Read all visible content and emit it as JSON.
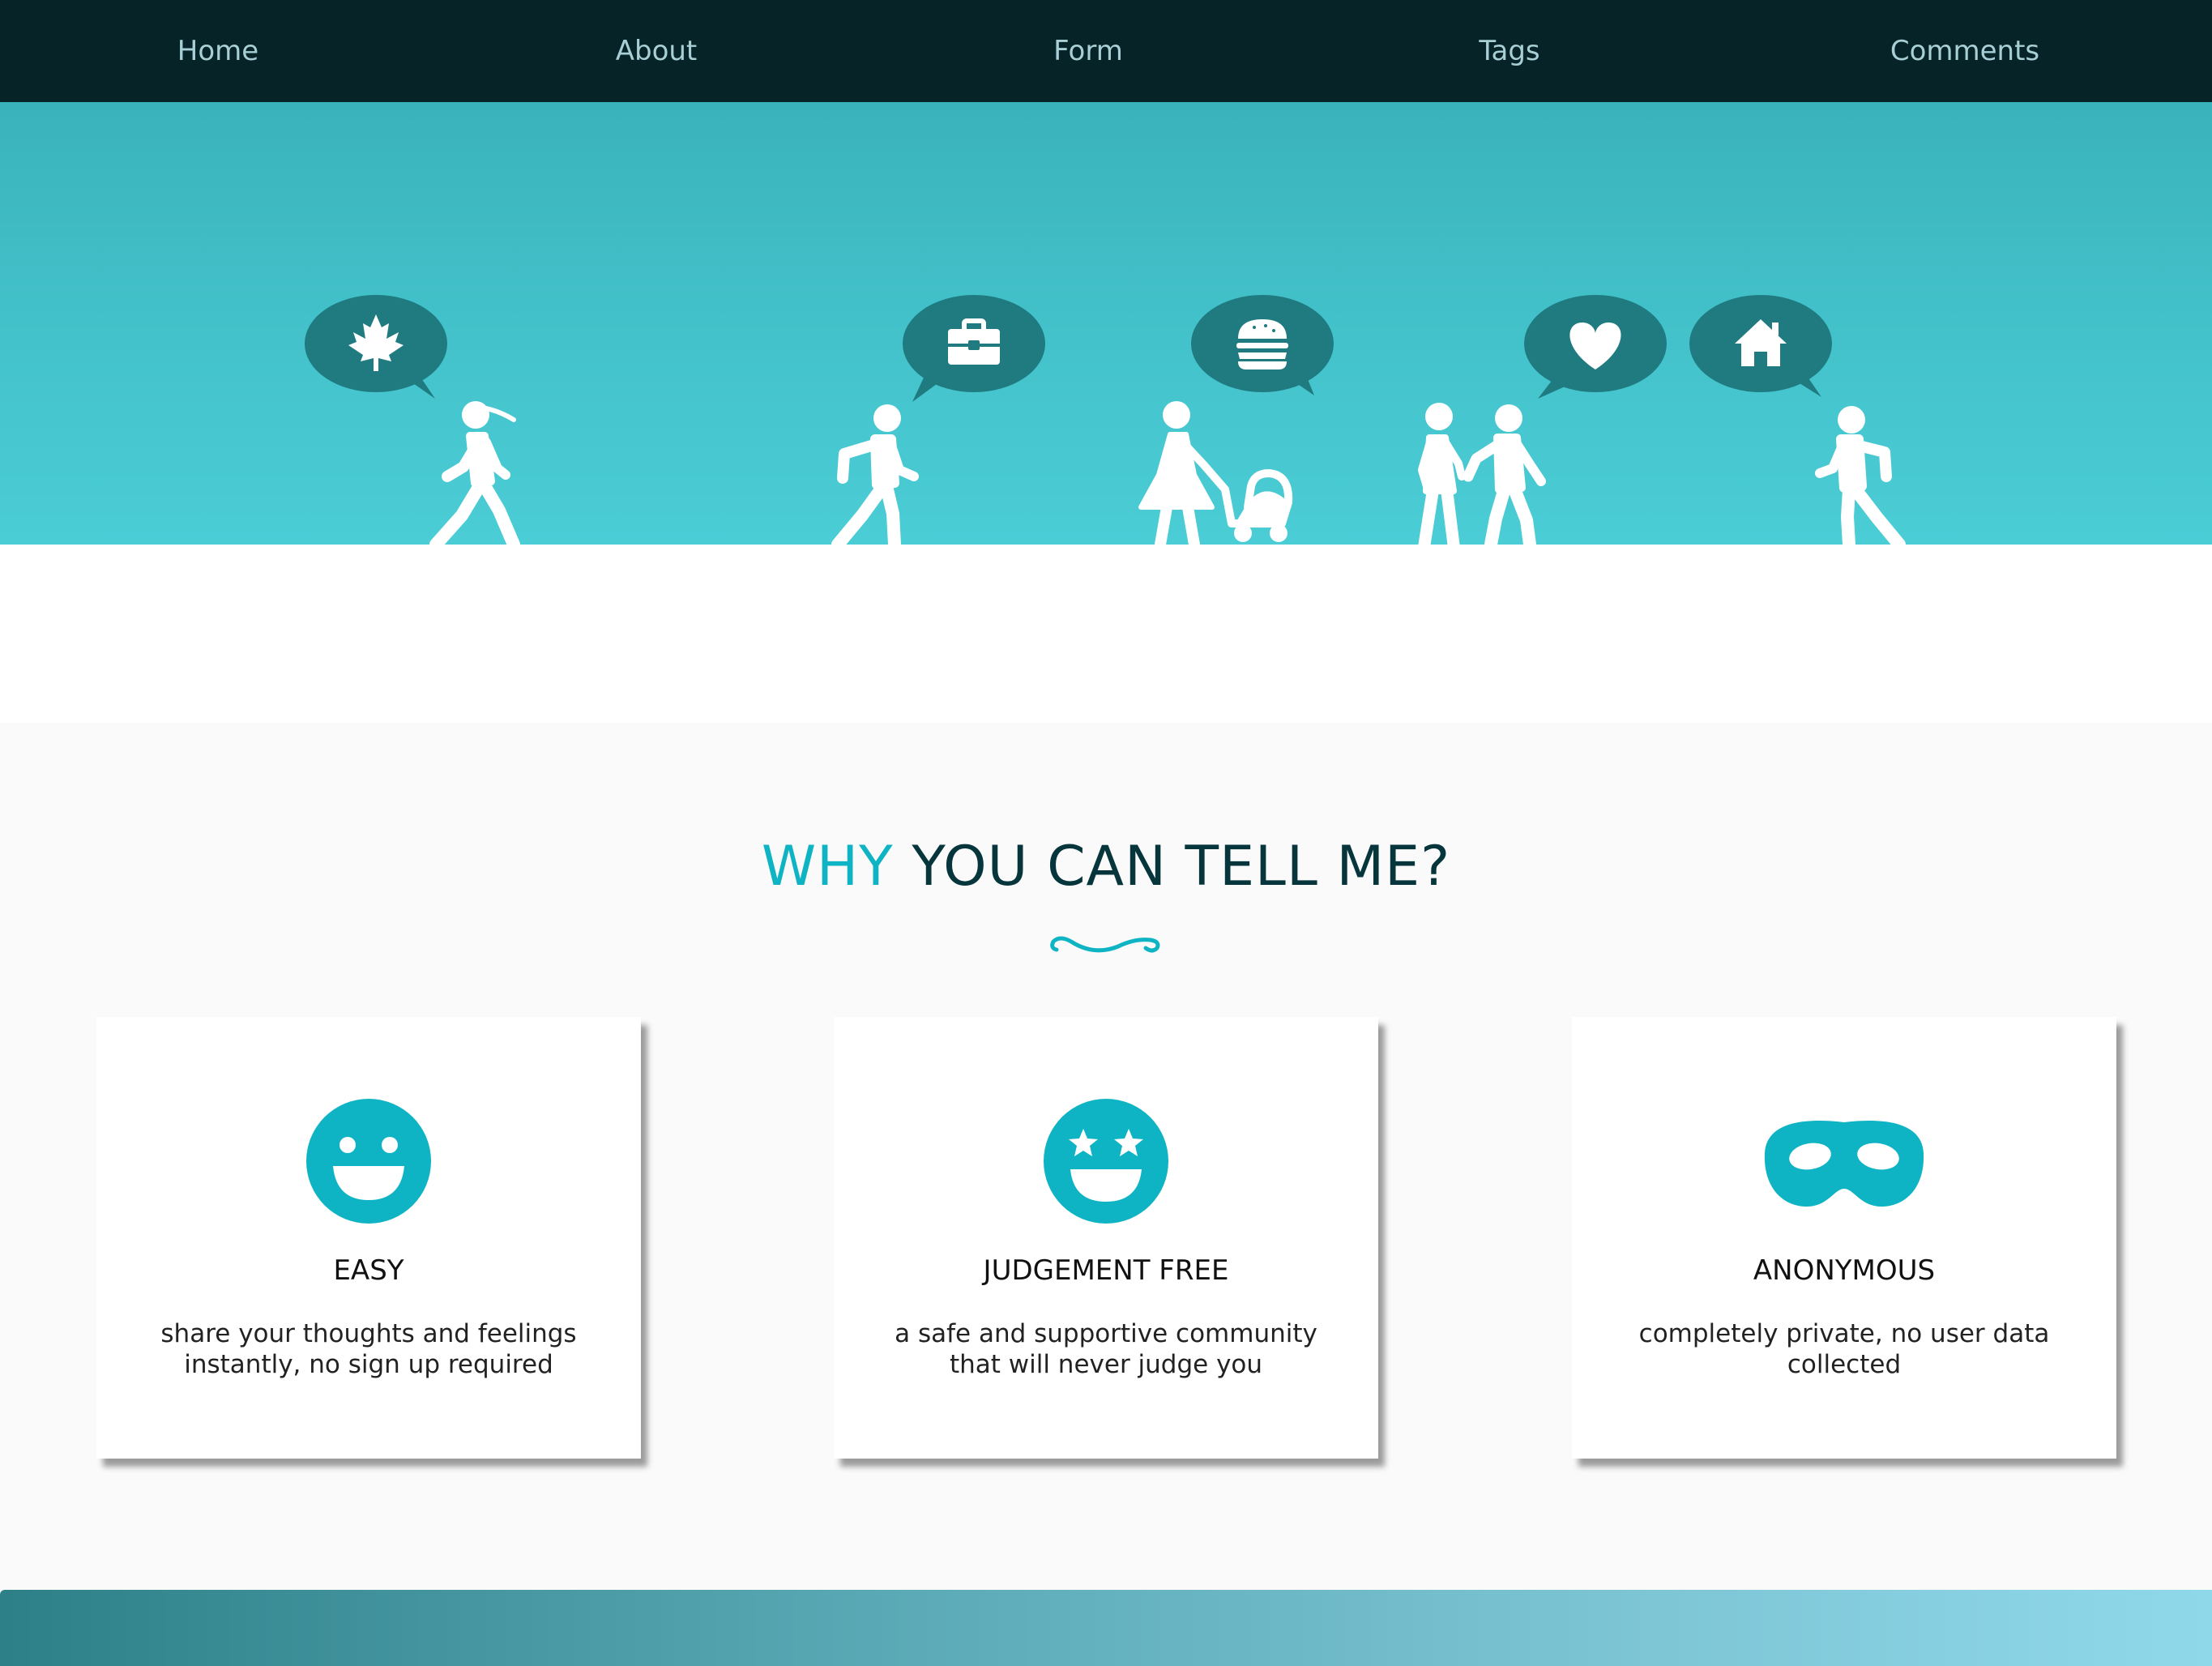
{
  "nav": {
    "items": [
      {
        "label": "Home"
      },
      {
        "label": "About"
      },
      {
        "label": "Form"
      },
      {
        "label": "Tags"
      },
      {
        "label": "Comments"
      }
    ]
  },
  "hero": {
    "bubbles": [
      "maple-leaf-icon",
      "briefcase-icon",
      "burger-icon",
      "heart-icon",
      "house-icon"
    ],
    "colors": {
      "teal": "#42c0c9",
      "bubble": "#1f7b80"
    }
  },
  "why": {
    "title_accent": "WHY",
    "title_rest": "YOU CAN TELL ME?"
  },
  "features": [
    {
      "icon": "grinning-face-icon",
      "title": "EASY",
      "line1": "share your thoughts and feelings",
      "line2": "instantly, no sign up required"
    },
    {
      "icon": "star-struck-face-icon",
      "title": "JUDGEMENT FREE",
      "line1": "a safe and supportive community",
      "line2": "that will never judge you"
    },
    {
      "icon": "mask-icon",
      "title": "ANONYMOUS",
      "line1": "completely private, no user data",
      "line2": "collected"
    }
  ],
  "colors": {
    "accent": "#0fb4c4",
    "nav_bg": "#062327",
    "heading": "#07353c"
  }
}
